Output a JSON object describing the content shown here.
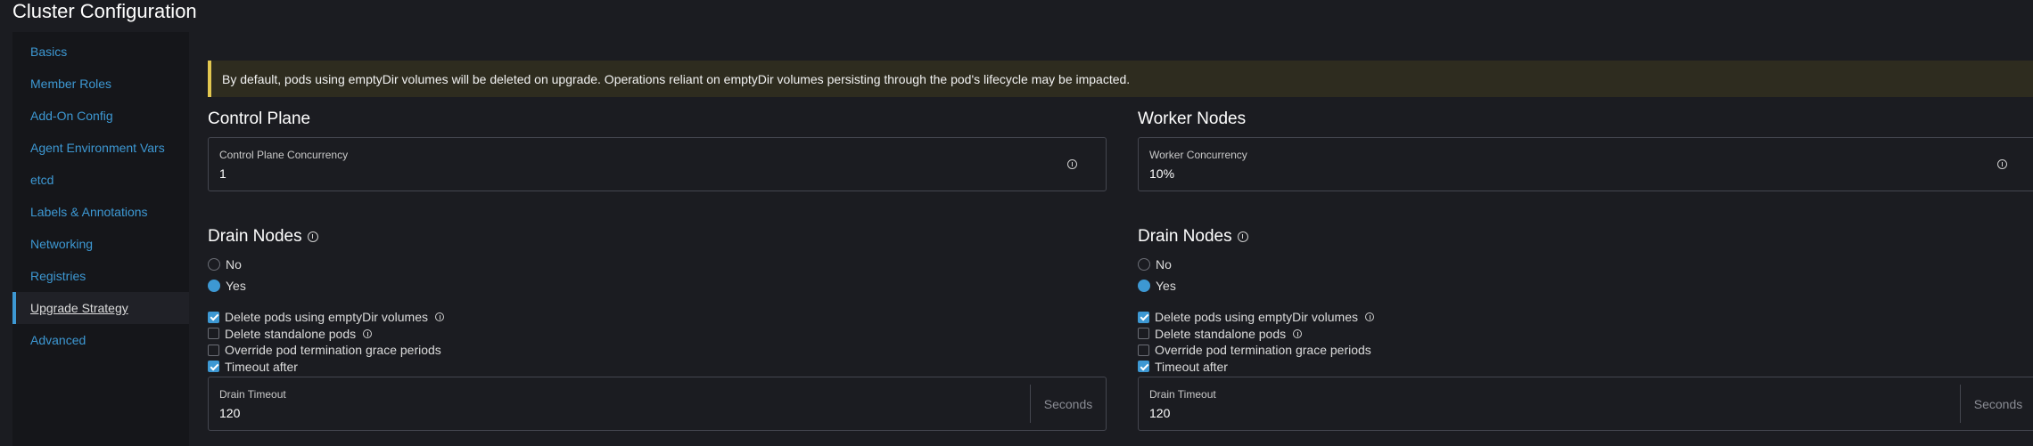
{
  "page": {
    "title": "Cluster Configuration"
  },
  "sidebar": {
    "items": [
      {
        "label": "Basics",
        "active": false
      },
      {
        "label": "Member Roles",
        "active": false
      },
      {
        "label": "Add-On Config",
        "active": false
      },
      {
        "label": "Agent Environment Vars",
        "active": false
      },
      {
        "label": "etcd",
        "active": false
      },
      {
        "label": "Labels & Annotations",
        "active": false
      },
      {
        "label": "Networking",
        "active": false
      },
      {
        "label": "Registries",
        "active": false
      },
      {
        "label": "Upgrade Strategy",
        "active": true
      },
      {
        "label": "Advanced",
        "active": false
      }
    ]
  },
  "banner": {
    "text": "By default, pods using emptyDir volumes will be deleted on upgrade. Operations reliant on emptyDir volumes persisting through the pod's lifecycle may be impacted."
  },
  "control_plane": {
    "title": "Control Plane",
    "concurrency": {
      "label": "Control Plane Concurrency",
      "value": "1"
    },
    "drain": {
      "title": "Drain Nodes",
      "options": {
        "no": "No",
        "yes": "Yes",
        "selected": "Yes"
      },
      "checks": {
        "delete_empty_dir": {
          "label": "Delete pods using emptyDir volumes",
          "checked": true
        },
        "delete_standalone": {
          "label": "Delete standalone pods",
          "checked": false
        },
        "override_grace": {
          "label": "Override pod termination grace periods",
          "checked": false
        },
        "timeout_after": {
          "label": "Timeout after",
          "checked": true
        }
      },
      "timeout": {
        "label": "Drain Timeout",
        "value": "120",
        "suffix": "Seconds"
      }
    }
  },
  "worker_nodes": {
    "title": "Worker Nodes",
    "concurrency": {
      "label": "Worker Concurrency",
      "value": "10%"
    },
    "drain": {
      "title": "Drain Nodes",
      "options": {
        "no": "No",
        "yes": "Yes",
        "selected": "Yes"
      },
      "checks": {
        "delete_empty_dir": {
          "label": "Delete pods using emptyDir volumes",
          "checked": true
        },
        "delete_standalone": {
          "label": "Delete standalone pods",
          "checked": false
        },
        "override_grace": {
          "label": "Override pod termination grace periods",
          "checked": false
        },
        "timeout_after": {
          "label": "Timeout after",
          "checked": true
        }
      },
      "timeout": {
        "label": "Drain Timeout",
        "value": "120",
        "suffix": "Seconds"
      }
    }
  },
  "colors": {
    "accent": "#3d98d3",
    "banner_border": "#e2c750",
    "banner_bg": "#2e2c1f",
    "background": "#1b1c21"
  }
}
